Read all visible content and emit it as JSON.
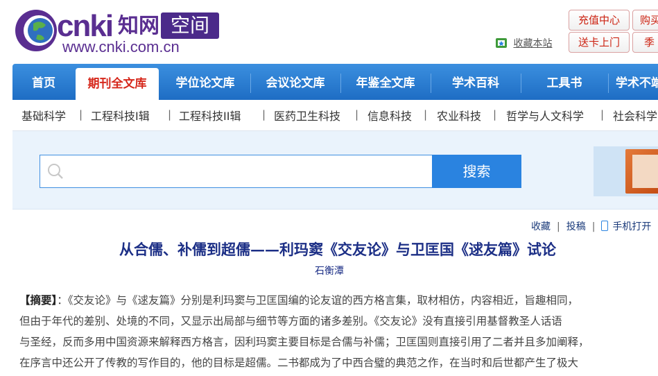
{
  "logo": {
    "cnki": "cnki",
    "zhi": "知网",
    "space": "空间",
    "url": "www.cnki.com.cn"
  },
  "header": {
    "favorite_label": "收藏本站",
    "recharge_label": "充值中心",
    "buy_label": "购买",
    "card_label": "送卡上门",
    "season_label": "季"
  },
  "nav": {
    "items": [
      "首页",
      "期刊全文库",
      "学位论文库",
      "会议论文库",
      "年鉴全文库",
      "学术百科",
      "工具书",
      "学术不端"
    ]
  },
  "subnav": {
    "items": [
      "基础科学",
      "工程科技I辑",
      "工程科技II辑",
      "医药卫生科技",
      "信息科技",
      "农业科技",
      "哲学与人文科学",
      "社会科学"
    ]
  },
  "search": {
    "placeholder": "",
    "button_label": "搜索"
  },
  "article": {
    "tools": {
      "favorite": "收藏",
      "submit": "投稿",
      "mobile": "手机打开"
    },
    "title": "从合儒、补儒到超儒——利玛窦《交友论》与卫匡国《逑友篇》试论",
    "author": "石衡潭",
    "abstract_label": "【摘要】",
    "abstract_lines": [
      "：《交友论》与《逑友篇》分别是利玛窦与卫匡国编的论友谊的西方格言集，取材相仿，内容相近，旨趣相同，",
      "但由于年代的差别、处境的不同，又显示出局部与细节等方面的诸多差别。《交友论》没有直接引用基督教圣人话语",
      "与圣经，反而多用中国资源来解释西方格言，因利玛窦主要目标是合儒与补儒；卫匡国则直接引用了二者并且多加阐释，",
      "在序言中还公开了传教的写作目的，他的目标是超儒。二书都成为了中西合璧的典范之作，在当时和后世都产生了极大"
    ]
  },
  "colors": {
    "nav_blue": "#1e6dc4",
    "active_red": "#d6281c",
    "title_blue": "#1c2f86",
    "logo_purple": "#5a2e91"
  }
}
